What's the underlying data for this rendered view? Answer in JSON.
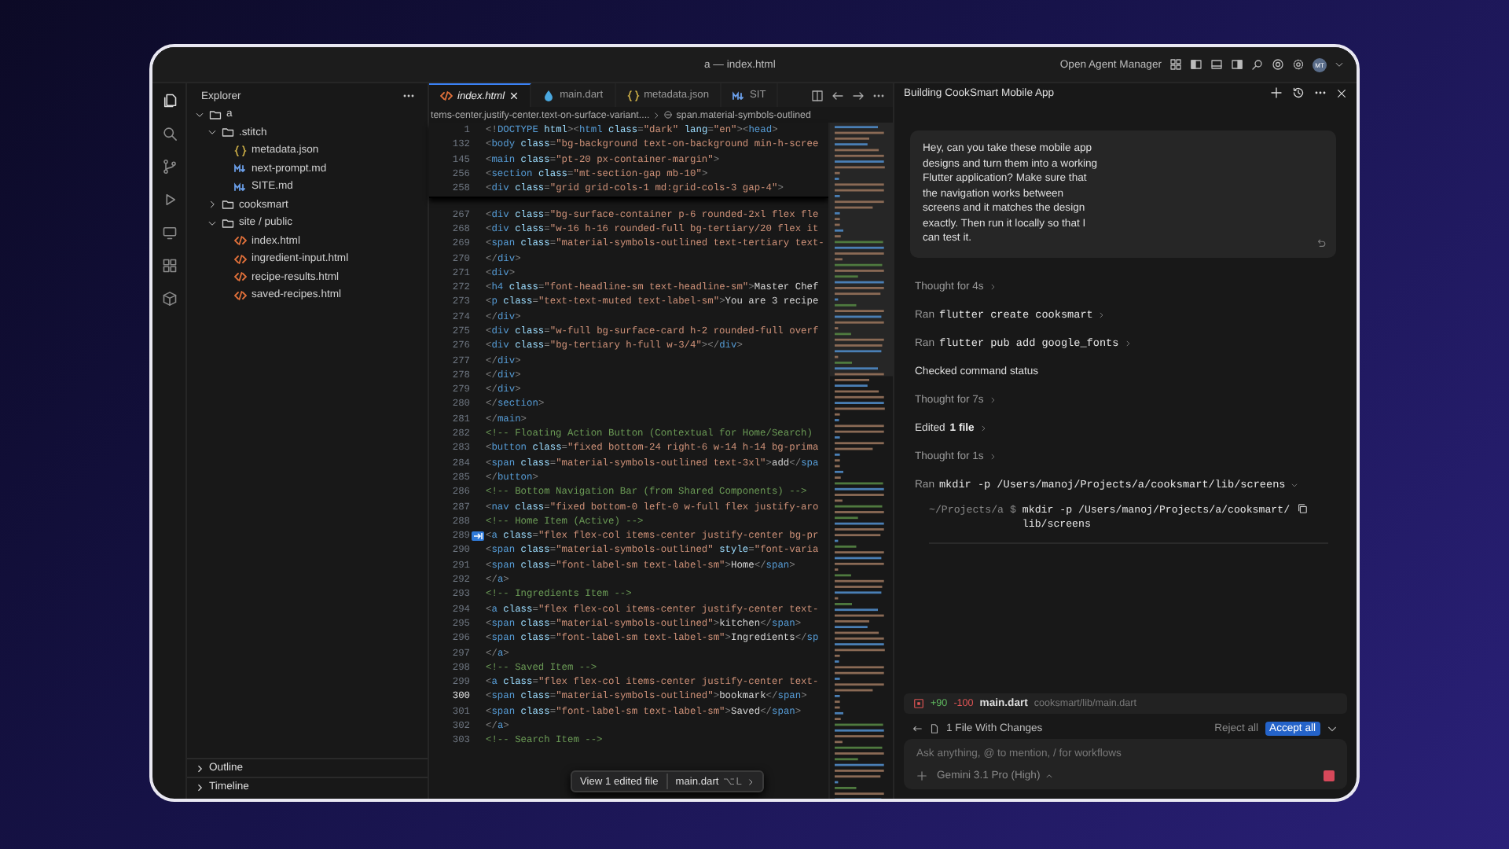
{
  "window": {
    "title": "a — index.html",
    "agent_manager": "Open Agent Manager",
    "avatar": "MT"
  },
  "explorer": {
    "title": "Explorer",
    "tree": [
      {
        "name": "a",
        "kind": "folder",
        "expanded": true,
        "children": [
          {
            "name": ".stitch",
            "kind": "folder",
            "expanded": true,
            "children": [
              {
                "name": "metadata.json",
                "kind": "json"
              },
              {
                "name": "next-prompt.md",
                "kind": "md"
              },
              {
                "name": "SITE.md",
                "kind": "md"
              }
            ]
          },
          {
            "name": "cooksmart",
            "kind": "folder",
            "expanded": false
          },
          {
            "name": "site / public",
            "kind": "folder",
            "expanded": true,
            "children": [
              {
                "name": "index.html",
                "kind": "html"
              },
              {
                "name": "ingredient-input.html",
                "kind": "html"
              },
              {
                "name": "recipe-results.html",
                "kind": "html"
              },
              {
                "name": "saved-recipes.html",
                "kind": "html"
              }
            ]
          }
        ]
      }
    ],
    "sections": [
      {
        "label": "Outline",
        "expanded": false
      },
      {
        "label": "Timeline",
        "expanded": false
      }
    ]
  },
  "tabs": [
    {
      "label": "index.html",
      "kind": "html",
      "selected": true
    },
    {
      "label": "main.dart",
      "kind": "dart",
      "selected": false
    },
    {
      "label": "metadata.json",
      "kind": "json",
      "selected": false
    },
    {
      "label": "SIT",
      "kind": "md",
      "selected": false
    }
  ],
  "breadcrumbs": [
    "tems-center.justify-center.text-on-surface-variant....",
    "span.material-symbols-outlined"
  ],
  "sticky_lines": [
    {
      "n": "1",
      "code": "<!DOCTYPE html><html class=\"dark\" lang=\"en\"><head>"
    },
    {
      "n": "132",
      "code": "<body class=\"bg-background text-on-background min-h-scree"
    },
    {
      "n": "145",
      "code": "<main class=\"pt-20 px-container-margin\">"
    },
    {
      "n": "256",
      "code": "<section class=\"mt-section-gap mb-10\">"
    },
    {
      "n": "258",
      "code": "<div class=\"grid grid-cols-1 md:grid-cols-3 gap-4\">"
    }
  ],
  "lines": [
    {
      "n": "267",
      "code": "<div class=\"bg-surface-container p-6 rounded-2xl flex fle",
      "current": false,
      "suggestion": false
    },
    {
      "n": "268",
      "code": "<div class=\"w-16 h-16 rounded-full bg-tertiary/20 flex it",
      "current": false,
      "suggestion": false
    },
    {
      "n": "269",
      "code": "<span class=\"material-symbols-outlined text-tertiary text-",
      "current": false,
      "suggestion": false
    },
    {
      "n": "270",
      "code": "</div>",
      "current": false,
      "suggestion": false
    },
    {
      "n": "271",
      "code": "<div>",
      "current": false,
      "suggestion": false
    },
    {
      "n": "272",
      "code": "<h4 class=\"font-headline-sm text-headline-sm\">Master Chef",
      "current": false,
      "suggestion": false
    },
    {
      "n": "273",
      "code": "<p class=\"text-text-muted text-label-sm\">You are 3 recipe",
      "current": false,
      "suggestion": false
    },
    {
      "n": "274",
      "code": "</div>",
      "current": false,
      "suggestion": false
    },
    {
      "n": "275",
      "code": "<div class=\"w-full bg-surface-card h-2 rounded-full overf",
      "current": false,
      "suggestion": false
    },
    {
      "n": "276",
      "code": "<div class=\"bg-tertiary h-full w-3/4\"></div>",
      "current": false,
      "suggestion": false
    },
    {
      "n": "277",
      "code": "</div>",
      "current": false,
      "suggestion": false
    },
    {
      "n": "278",
      "code": "</div>",
      "current": false,
      "suggestion": false
    },
    {
      "n": "279",
      "code": "</div>",
      "current": false,
      "suggestion": false
    },
    {
      "n": "280",
      "code": "</section>",
      "current": false,
      "suggestion": false
    },
    {
      "n": "281",
      "code": "</main>",
      "current": false,
      "suggestion": false
    },
    {
      "n": "282",
      "code": "<!-- Floating Action Button (Contextual for Home/Search)",
      "current": false,
      "suggestion": false
    },
    {
      "n": "283",
      "code": "<button class=\"fixed bottom-24 right-6 w-14 h-14 bg-prima",
      "current": false,
      "suggestion": false
    },
    {
      "n": "284",
      "code": "<span class=\"material-symbols-outlined text-3xl\">add</spa",
      "current": false,
      "suggestion": false
    },
    {
      "n": "285",
      "code": "</button>",
      "current": false,
      "suggestion": false
    },
    {
      "n": "286",
      "code": "<!-- Bottom Navigation Bar (from Shared Components) -->",
      "current": false,
      "suggestion": false
    },
    {
      "n": "287",
      "code": "<nav class=\"fixed bottom-0 left-0 w-full flex justify-aro",
      "current": false,
      "suggestion": false
    },
    {
      "n": "288",
      "code": "<!-- Home Item (Active) -->",
      "current": false,
      "suggestion": false
    },
    {
      "n": "289",
      "code": "<a class=\"flex flex-col items-center justify-center bg-pr",
      "current": false,
      "suggestion": true
    },
    {
      "n": "290",
      "code": "<span class=\"material-symbols-outlined\" style=\"font-varia",
      "current": false,
      "suggestion": false
    },
    {
      "n": "291",
      "code": "<span class=\"font-label-sm text-label-sm\">Home</span>",
      "current": false,
      "suggestion": false
    },
    {
      "n": "292",
      "code": "</a>",
      "current": false,
      "suggestion": false
    },
    {
      "n": "293",
      "code": "<!-- Ingredients Item -->",
      "current": false,
      "suggestion": false
    },
    {
      "n": "294",
      "code": "<a class=\"flex flex-col items-center justify-center text-",
      "current": false,
      "suggestion": false
    },
    {
      "n": "295",
      "code": "<span class=\"material-symbols-outlined\">kitchen</span>",
      "current": false,
      "suggestion": false
    },
    {
      "n": "296",
      "code": "<span class=\"font-label-sm text-label-sm\">Ingredients</sp",
      "current": false,
      "suggestion": false
    },
    {
      "n": "297",
      "code": "</a>",
      "current": false,
      "suggestion": false
    },
    {
      "n": "298",
      "code": "<!-- Saved Item -->",
      "current": false,
      "suggestion": false
    },
    {
      "n": "299",
      "code": "<a class=\"flex flex-col items-center justify-center text-",
      "current": false,
      "suggestion": false
    },
    {
      "n": "300",
      "code": "<span class=\"material-symbols-outlined\">bookmark</span>",
      "current": true,
      "suggestion": false
    },
    {
      "n": "301",
      "code": "<span class=\"font-label-sm text-label-sm\">Saved</span>",
      "current": false,
      "suggestion": false
    },
    {
      "n": "302",
      "code": "</a>",
      "current": false,
      "suggestion": false
    },
    {
      "n": "303",
      "code": "<!-- Search Item -->",
      "current": false,
      "suggestion": false
    }
  ],
  "edit_popup": {
    "action": "View 1 edited file",
    "file": "main.dart",
    "shortcut": "⌥L"
  },
  "agent": {
    "title": "Building CookSmart Mobile App",
    "message": "Hey, can you take these mobile app designs and turn them into a working Flutter application? Make sure that the navigation works between screens and it matches the design exactly. Then run it locally so that I can test it.",
    "steps": [
      {
        "kind": "thought",
        "label": "Thought for 4s",
        "expanded": false
      },
      {
        "kind": "ran",
        "label": "Ran",
        "command": "flutter create cooksmart",
        "expanded": false
      },
      {
        "kind": "ran",
        "label": "Ran",
        "command": "flutter pub add google_fonts",
        "expanded": false
      },
      {
        "kind": "status",
        "label": "Checked command status"
      },
      {
        "kind": "thought",
        "label": "Thought for 7s",
        "expanded": false
      },
      {
        "kind": "edited",
        "label": "Edited",
        "detail": "1 file",
        "expanded": false
      },
      {
        "kind": "thought",
        "label": "Thought for 1s",
        "expanded": false
      },
      {
        "kind": "ran",
        "label": "Ran",
        "command": "mkdir -p /Users/manoj/Projects/a/cooksmart/lib/screens",
        "expanded": true,
        "output": {
          "prompt": "~/Projects/a $",
          "lines": [
            "mkdir -p /Users/manoj/Projects/a/cooksmart/",
            "lib/screens"
          ]
        }
      }
    ],
    "change": {
      "added": "+90",
      "removed": "-100",
      "file": "main.dart",
      "path": "cooksmart/lib/main.dart"
    },
    "changes_summary": "1 File With Changes",
    "reject": "Reject all",
    "accept": "Accept all",
    "input": {
      "placeholder": "Ask anything, @ to mention, / for workflows"
    },
    "model": "Gemini 3.1 Pro (High)"
  }
}
